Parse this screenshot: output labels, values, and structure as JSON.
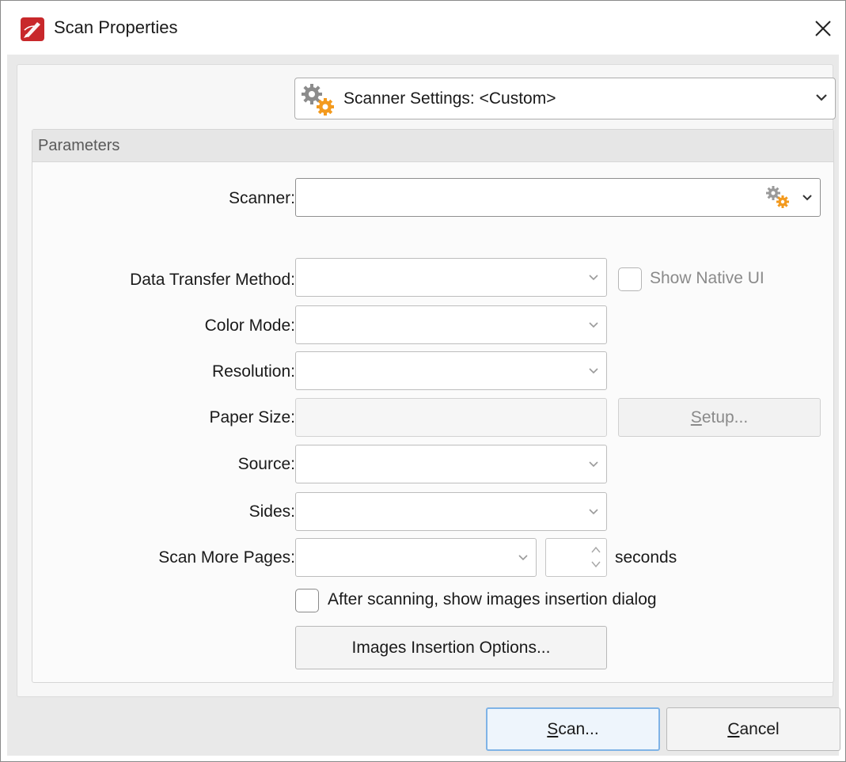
{
  "window": {
    "title": "Scan Properties",
    "close_glyph": "✕"
  },
  "icons": {
    "app": "pdf-app-icon",
    "close": "close-icon",
    "settings": "gears-icon",
    "chevron": "chevron-down-icon",
    "spin": "spinner-arrows-icon"
  },
  "scanner_settings": {
    "label": "Scanner Settings:  <Custom>"
  },
  "parameters": {
    "header": "Parameters",
    "scanner": {
      "label": "Scanner:",
      "value": ""
    },
    "data_transfer": {
      "label": "Data Transfer Method:",
      "value": ""
    },
    "show_native_ui": {
      "label": "Show Native UI",
      "checked": false
    },
    "color_mode": {
      "label": "Color Mode:",
      "value": ""
    },
    "resolution": {
      "label": "Resolution:",
      "value": ""
    },
    "paper_size": {
      "label": "Paper Size:",
      "value": ""
    },
    "setup_button": {
      "mnemonic": "S",
      "rest": "etup..."
    },
    "source": {
      "label": "Source:",
      "value": ""
    },
    "sides": {
      "label": "Sides:",
      "value": ""
    },
    "scan_more_pages": {
      "label": "Scan More Pages:",
      "value": "",
      "seconds_value": "",
      "seconds_label": "seconds"
    },
    "after_scanning": {
      "label": "After scanning, show images insertion dialog",
      "checked": false
    },
    "images_insertion_button": "Images Insertion Options..."
  },
  "footer": {
    "scan_button": {
      "mnemonic": "S",
      "rest": "can..."
    },
    "cancel_button": {
      "mnemonic": "C",
      "rest": "ancel"
    }
  },
  "colors": {
    "accent_border": "#7fb3e6",
    "icon_red": "#c8282b",
    "gear_orange": "#f39a1e",
    "gear_gray": "#8c8c8c"
  }
}
